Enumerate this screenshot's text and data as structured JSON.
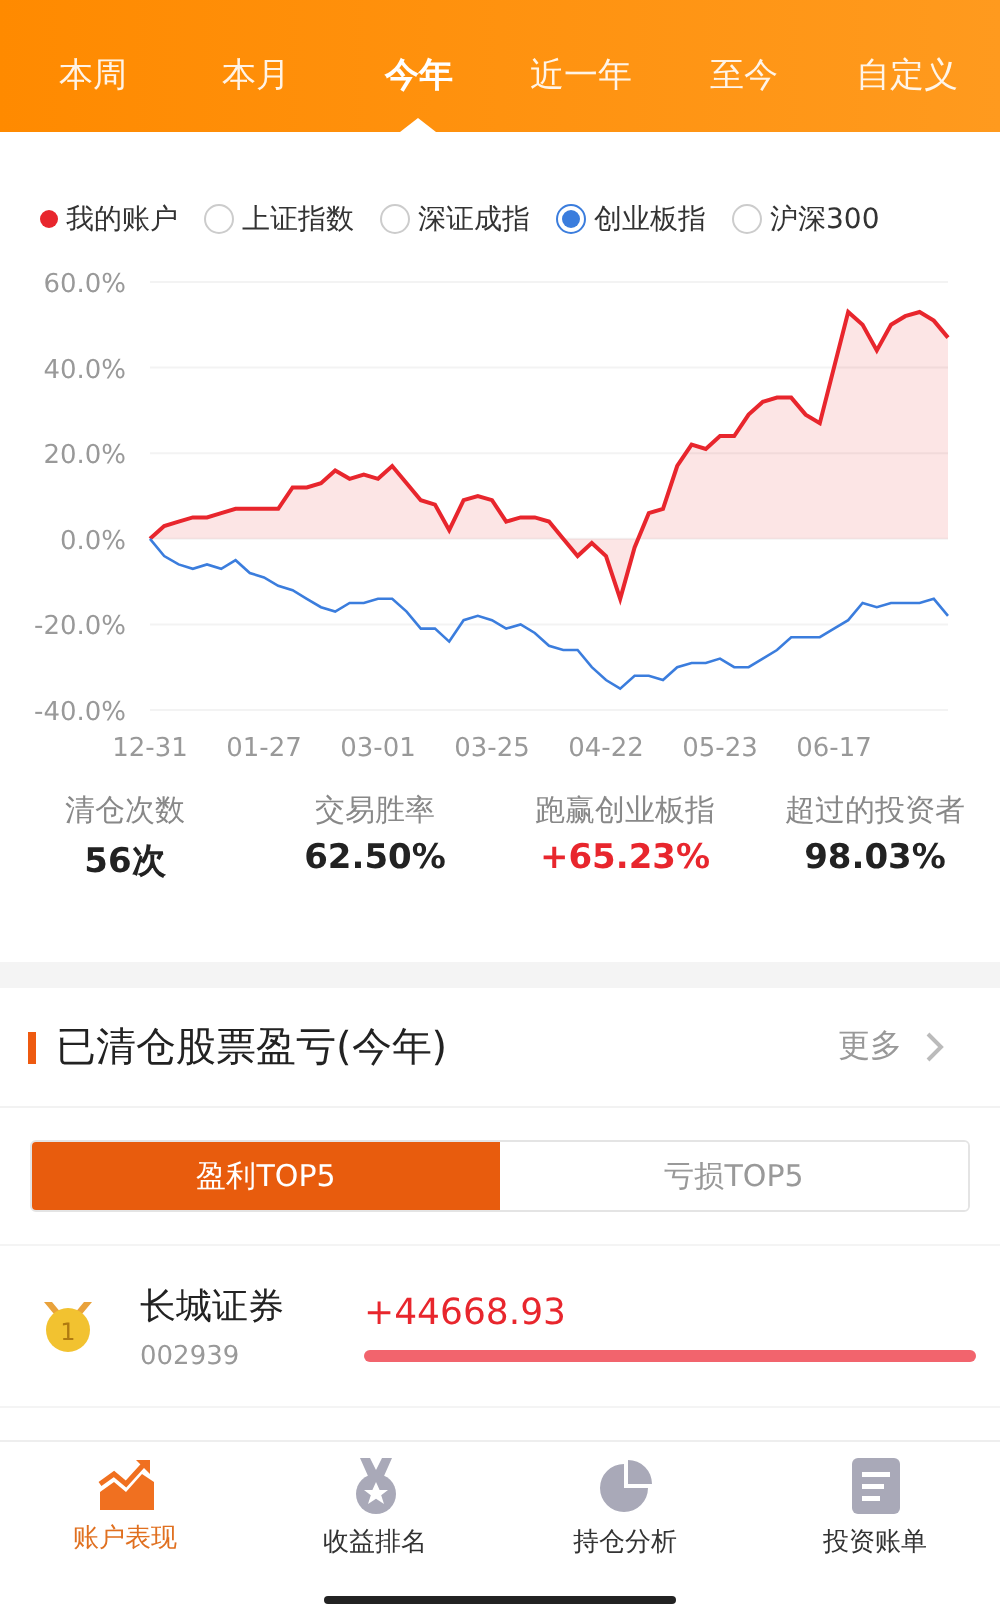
{
  "period_tabs": [
    {
      "label": "本周",
      "selected": false
    },
    {
      "label": "本月",
      "selected": false
    },
    {
      "label": "今年",
      "selected": true
    },
    {
      "label": "近一年",
      "selected": false
    },
    {
      "label": "至今",
      "selected": false
    },
    {
      "label": "自定义",
      "selected": false
    }
  ],
  "legend": [
    {
      "kind": "series",
      "label": "我的账户",
      "color": "#e8262d"
    },
    {
      "kind": "radio",
      "label": "上证指数",
      "selected": false
    },
    {
      "kind": "radio",
      "label": "深证成指",
      "selected": false
    },
    {
      "kind": "radio",
      "label": "创业板指",
      "selected": true
    },
    {
      "kind": "radio",
      "label": "沪深300",
      "selected": false
    }
  ],
  "chart_data": {
    "type": "area",
    "grid": true,
    "categories": [
      "12-31",
      null,
      null,
      null,
      null,
      null,
      null,
      null,
      "01-27",
      null,
      null,
      null,
      null,
      null,
      null,
      null,
      "03-01",
      null,
      null,
      null,
      null,
      null,
      null,
      null,
      "03-25",
      null,
      null,
      null,
      null,
      null,
      null,
      null,
      "04-22",
      null,
      null,
      null,
      null,
      null,
      null,
      null,
      "05-23",
      null,
      null,
      null,
      null,
      null,
      null,
      null,
      "06-17",
      null,
      null,
      null,
      null,
      null,
      null,
      null,
      null
    ],
    "series": [
      {
        "type": "area",
        "color": "#e8262d",
        "values": [
          0,
          3,
          4,
          5,
          5,
          6,
          7,
          7,
          7,
          7,
          12,
          12,
          13,
          16,
          14,
          15,
          14,
          17,
          13,
          9,
          8,
          2,
          9,
          10,
          9,
          4,
          5,
          5,
          4,
          0,
          -4,
          -1,
          -4,
          -14,
          -2,
          6,
          7,
          17,
          22,
          21,
          24,
          24,
          29,
          32,
          33,
          33,
          29,
          27,
          40,
          53,
          50,
          44,
          50,
          52,
          53,
          51,
          47
        ]
      },
      {
        "type": "line",
        "color": "#3b7ddd",
        "values": [
          0,
          -4,
          -6,
          -7,
          -6,
          -7,
          -5,
          -8,
          -9,
          -11,
          -12,
          -14,
          -16,
          -17,
          -15,
          -15,
          -14,
          -14,
          -17,
          -21,
          -21,
          -24,
          -19,
          -18,
          -19,
          -21,
          -20,
          -22,
          -25,
          -26,
          -26,
          -30,
          -33,
          -35,
          -32,
          -32,
          -33,
          -30,
          -29,
          -29,
          -28,
          -30,
          -30,
          -28,
          -26,
          -23,
          -23,
          -23,
          -21,
          -19,
          -15,
          -16,
          -15,
          -15,
          -15,
          -14,
          -18
        ]
      }
    ],
    "ylim": [
      -40,
      60
    ],
    "yticks": [
      {
        "value": 60,
        "label": "60.0%"
      },
      {
        "value": 40,
        "label": "40.0%"
      },
      {
        "value": 20,
        "label": "20.0%"
      },
      {
        "value": 0,
        "label": "0.0%"
      },
      {
        "value": -20,
        "label": "-20.0%"
      },
      {
        "value": -40,
        "label": "-40.0%"
      }
    ]
  },
  "stats": [
    {
      "label": "清仓次数",
      "value": "56次",
      "positive": false
    },
    {
      "label": "交易胜率",
      "value": "62.50%",
      "positive": false
    },
    {
      "label": "跑赢创业板指",
      "value": "+65.23%",
      "positive": true
    },
    {
      "label": "超过的投资者",
      "value": "98.03%",
      "positive": false
    }
  ],
  "section": {
    "title": "已清仓股票盈亏(今年)",
    "more": "更多"
  },
  "toggle": [
    {
      "label": "盈利TOP5",
      "selected": true
    },
    {
      "label": "亏损TOP5",
      "selected": false
    }
  ],
  "rows": [
    {
      "rank": "1",
      "name": "长城证券",
      "code": "002939",
      "amount": "+44668.93",
      "level": 1
    }
  ],
  "bottom_nav": [
    {
      "label": "账户表现",
      "kind": "trend",
      "selected": true
    },
    {
      "label": "收益排名",
      "kind": "medal",
      "selected": false
    },
    {
      "label": "持仓分析",
      "kind": "pie",
      "selected": false
    },
    {
      "label": "投资账单",
      "kind": "doc",
      "selected": false
    }
  ]
}
